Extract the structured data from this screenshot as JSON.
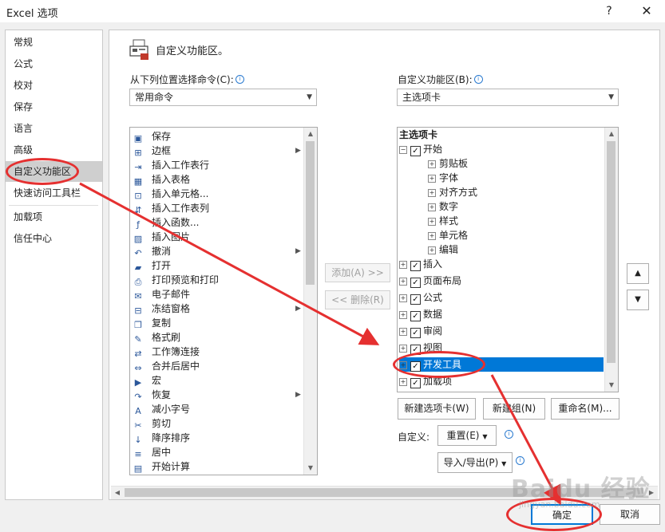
{
  "window": {
    "title": "Excel 选项",
    "help_glyph": "?",
    "close_glyph": "✕"
  },
  "nav": {
    "items": [
      {
        "label": "常规"
      },
      {
        "label": "公式"
      },
      {
        "label": "校对"
      },
      {
        "label": "保存"
      },
      {
        "label": "语言"
      },
      {
        "label": "高级"
      },
      {
        "label": "自定义功能区",
        "selected": true
      },
      {
        "label": "快速访问工具栏"
      },
      {
        "label": "加载项"
      },
      {
        "label": "信任中心"
      }
    ]
  },
  "header": {
    "title": "自定义功能区。"
  },
  "left_pane": {
    "choose_label": "从下列位置选择命令(C):",
    "choose_value": "常用命令",
    "commands": [
      {
        "label": "保存",
        "icon": "save-icon"
      },
      {
        "label": "边框",
        "icon": "border-icon",
        "submenu": true
      },
      {
        "label": "插入工作表行",
        "icon": "insert-row-icon"
      },
      {
        "label": "插入表格",
        "icon": "table-icon"
      },
      {
        "label": "插入单元格...",
        "icon": "insert-cell-icon"
      },
      {
        "label": "插入工作表列",
        "icon": "insert-column-icon"
      },
      {
        "label": "插入函数...",
        "icon": "function-icon"
      },
      {
        "label": "插入图片",
        "icon": "picture-icon"
      },
      {
        "label": "撤消",
        "icon": "undo-icon",
        "submenu": true
      },
      {
        "label": "打开",
        "icon": "open-folder-icon"
      },
      {
        "label": "打印预览和打印",
        "icon": "print-preview-icon"
      },
      {
        "label": "电子邮件",
        "icon": "email-icon"
      },
      {
        "label": "冻结窗格",
        "icon": "freeze-panes-icon",
        "submenu": true
      },
      {
        "label": "复制",
        "icon": "copy-icon"
      },
      {
        "label": "格式刷",
        "icon": "format-painter-icon"
      },
      {
        "label": "工作簿连接",
        "icon": "connections-icon"
      },
      {
        "label": "合并后居中",
        "icon": "merge-center-icon"
      },
      {
        "label": "宏",
        "icon": "macro-icon"
      },
      {
        "label": "恢复",
        "icon": "redo-icon",
        "submenu": true
      },
      {
        "label": "减小字号",
        "icon": "decrease-font-icon"
      },
      {
        "label": "剪切",
        "icon": "cut-icon"
      },
      {
        "label": "降序排序",
        "icon": "sort-desc-icon"
      },
      {
        "label": "居中",
        "icon": "center-icon"
      },
      {
        "label": "开始计算",
        "icon": "calculate-icon"
      }
    ]
  },
  "middle": {
    "add_label": "添加(A) >>",
    "remove_label": "<< 删除(R)"
  },
  "right_pane": {
    "customize_label": "自定义功能区(B):",
    "customize_value": "主选项卡",
    "tree_header": "主选项卡",
    "tree": [
      {
        "label": "开始",
        "level": 0,
        "expanded": true,
        "checked": true
      },
      {
        "label": "剪贴板",
        "level": 1
      },
      {
        "label": "字体",
        "level": 1
      },
      {
        "label": "对齐方式",
        "level": 1
      },
      {
        "label": "数字",
        "level": 1
      },
      {
        "label": "样式",
        "level": 1
      },
      {
        "label": "单元格",
        "level": 1
      },
      {
        "label": "编辑",
        "level": 1
      },
      {
        "label": "插入",
        "level": 0,
        "checked": true
      },
      {
        "label": "页面布局",
        "level": 0,
        "checked": true
      },
      {
        "label": "公式",
        "level": 0,
        "checked": true
      },
      {
        "label": "数据",
        "level": 0,
        "checked": true
      },
      {
        "label": "审阅",
        "level": 0,
        "checked": true
      },
      {
        "label": "视图",
        "level": 0,
        "checked": true
      },
      {
        "label": "开发工具",
        "level": 0,
        "checked": true,
        "selected": true
      },
      {
        "label": "加载项",
        "level": 0,
        "checked": true
      }
    ],
    "new_tab_label": "新建选项卡(W)",
    "new_group_label": "新建组(N)",
    "rename_label": "重命名(M)...",
    "customizations_label": "自定义:",
    "reset_label": "重置(E)",
    "import_export_label": "导入/导出(P)"
  },
  "footer": {
    "ok_label": "确定",
    "cancel_label": "取消"
  },
  "colors": {
    "selection": "#0078d7",
    "annotation": "#e53030"
  },
  "watermark": {
    "text": "Baidu 经验",
    "sub": "jingyan.baidu.com"
  }
}
